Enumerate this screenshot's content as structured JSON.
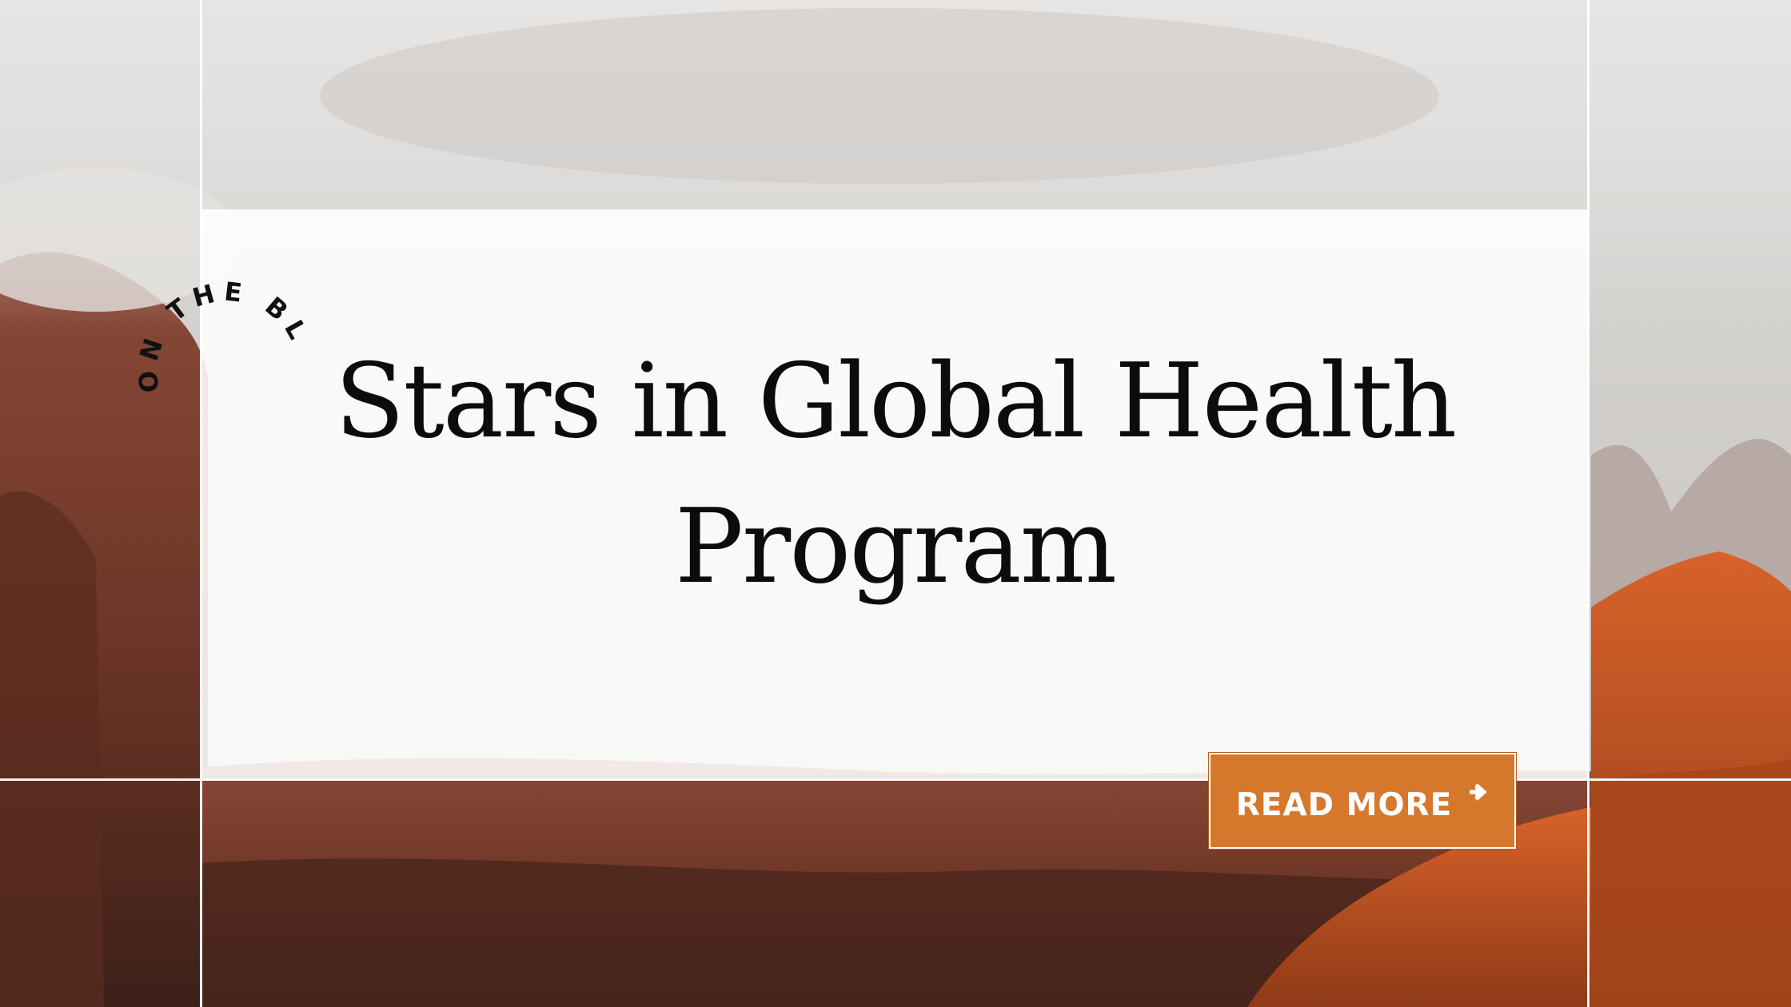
{
  "badge": {
    "text": "ON THE BLOG ON"
  },
  "post": {
    "title_line1": "Stars in Global Health",
    "title_line2": "Program"
  },
  "cta": {
    "label": "READ MORE",
    "icon": "arrow-right-icon",
    "color": "#d6782b"
  },
  "colors": {
    "accent": "#d6782b",
    "panel": "#ffffff",
    "text": "#0c0c0c"
  }
}
